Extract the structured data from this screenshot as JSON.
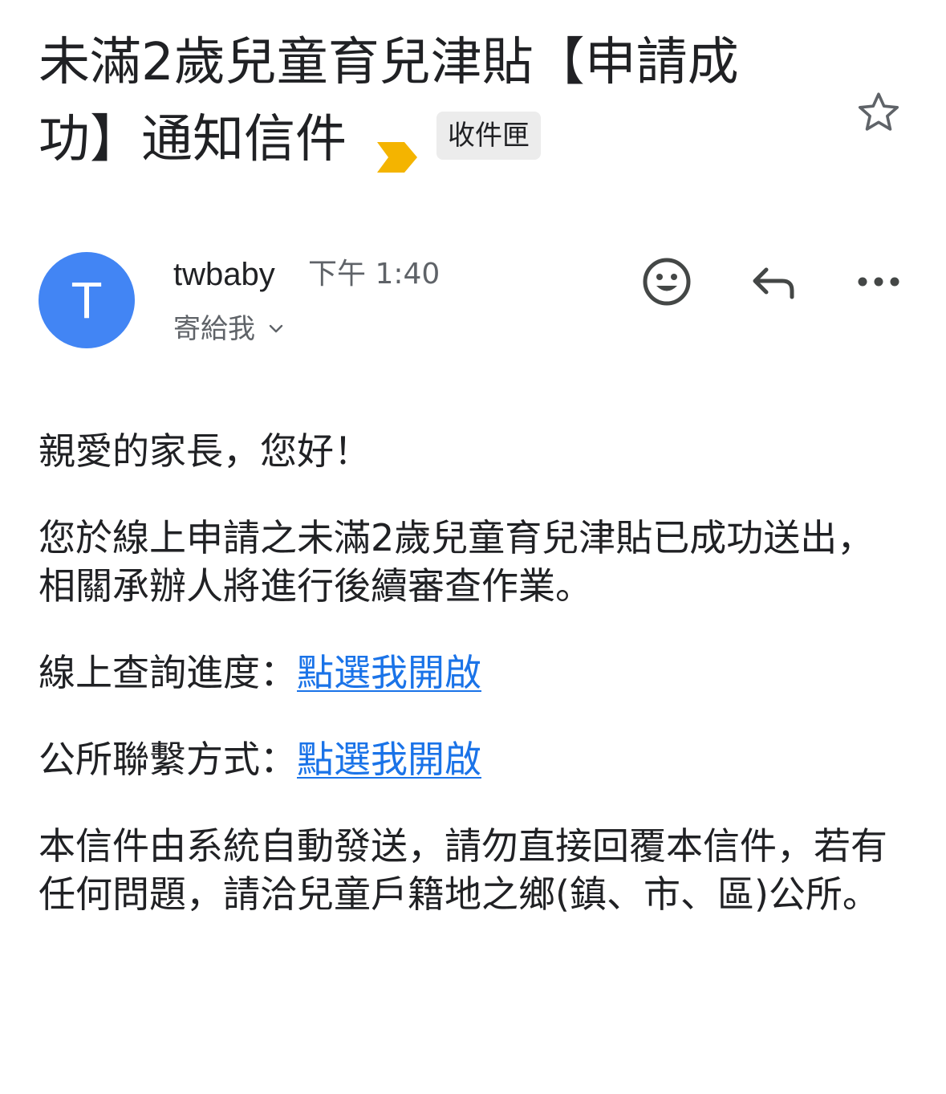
{
  "subject": {
    "title": "未滿2歲兒童育兒津貼【申請成功】通知信件",
    "label": "收件匣"
  },
  "icons": {
    "important": "importance-marker-icon",
    "star": "star-icon",
    "emoji": "emoji-reaction-icon",
    "reply": "reply-icon",
    "more": "more-options-icon",
    "expand": "chevron-down-icon"
  },
  "colors": {
    "avatar_bg": "#4285f4",
    "important_marker": "#f4b400",
    "link": "#1a73e8",
    "label_chip_bg": "#ececec"
  },
  "sender": {
    "avatar_letter": "T",
    "name": "twbaby",
    "time": "下午 1:40",
    "recipient": "寄給我"
  },
  "body": {
    "greeting": "親愛的家長，您好！",
    "sent_message": "您於線上申請之未滿2歲兒童育兒津貼已成功送出，相關承辦人將進行後續審查作業。",
    "query_label": "線上查詢進度：",
    "query_link": "點選我開啟",
    "contact_label": "公所聯繫方式：",
    "contact_link": "點選我開啟",
    "note": "本信件由系統自動發送，請勿直接回覆本信件，若有任何問題，請洽兒童戶籍地之鄉(鎮、市、區)公所。"
  }
}
